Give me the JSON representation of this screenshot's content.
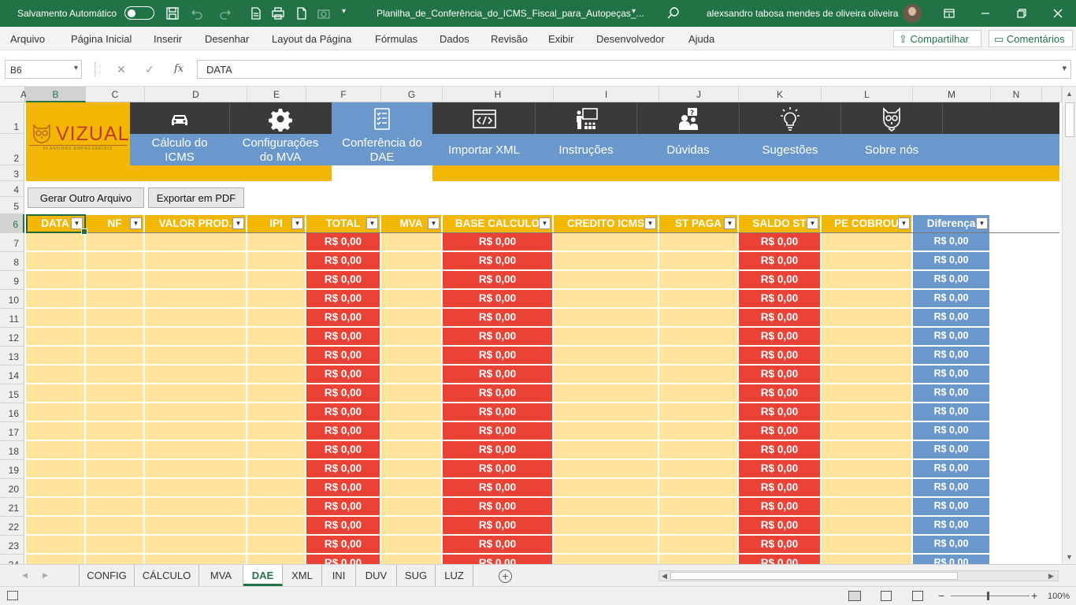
{
  "title_bar": {
    "autosave_label": "Salvamento Automático",
    "file_name": "Planilha_de_Conferência_do_ICMS_Fiscal_para_Autopeças_...",
    "user_name": "alexsandro tabosa mendes de oliveira oliveira"
  },
  "menu": {
    "items": [
      "Arquivo",
      "Página Inicial",
      "Inserir",
      "Desenhar",
      "Layout da Página",
      "Fórmulas",
      "Dados",
      "Revisão",
      "Exibir",
      "Desenvolvedor",
      "Ajuda"
    ],
    "share_label": "Compartilhar",
    "comments_label": "Comentários"
  },
  "formula_bar": {
    "name_box": "B6",
    "fx_label": "fx",
    "content": "DATA"
  },
  "columns": [
    "A",
    "B",
    "C",
    "D",
    "E",
    "F",
    "G",
    "H",
    "I",
    "J",
    "K",
    "L",
    "M",
    "N"
  ],
  "rows": [
    "1",
    "2",
    "3",
    "4",
    "5",
    "6",
    "7",
    "8",
    "9",
    "10",
    "11",
    "12",
    "13",
    "14",
    "15",
    "16",
    "17",
    "18",
    "19",
    "20",
    "21",
    "22",
    "23",
    "24"
  ],
  "logo": {
    "brand": "VIZUAL",
    "tagline": "PLANILHAS EMPRESARIAIS"
  },
  "nav": [
    {
      "label": "Cálculo do\nICMS",
      "icon": "car-icon",
      "active": false
    },
    {
      "label": "Configurações\ndo MVA",
      "icon": "gear-icon",
      "active": false
    },
    {
      "label": "Conferência do\nDAE",
      "icon": "checklist-icon",
      "active": true
    },
    {
      "label": "Importar XML",
      "icon": "code-window-icon",
      "active": false
    },
    {
      "label": "Instruções",
      "icon": "presentation-icon",
      "active": false
    },
    {
      "label": "Dúvidas",
      "icon": "question-person-icon",
      "active": false
    },
    {
      "label": "Sugestões",
      "icon": "lightbulb-icon",
      "active": false
    },
    {
      "label": "Sobre nós",
      "icon": "owl-icon",
      "active": false
    }
  ],
  "buttons": {
    "generate": "Gerar Outro Arquivo",
    "export_pdf": "Exportar em PDF"
  },
  "table": {
    "headers": [
      "DATA",
      "NF",
      "VALOR PROD.",
      "IPI",
      "TOTAL",
      "MVA",
      "BASE CALCULO",
      "CREDITO ICMS",
      "ST PAGA",
      "SALDO ST",
      "PE COBROU",
      "Diferença"
    ],
    "currency_value": "R$ 0,00",
    "row_count": 18
  },
  "sheet_tabs": [
    "CONFIG",
    "CÁLCULO",
    "MVA",
    "DAE",
    "XML",
    "INI",
    "DUV",
    "SUG",
    "LUZ"
  ],
  "active_sheet": "DAE",
  "status": {
    "zoom": "100%"
  },
  "colors": {
    "excel_green": "#217346",
    "yellow": "#f2b705",
    "light_yellow": "#fde49a",
    "red": "#ea4335",
    "blue": "#6a97cc",
    "dark": "#3a3a3a"
  }
}
